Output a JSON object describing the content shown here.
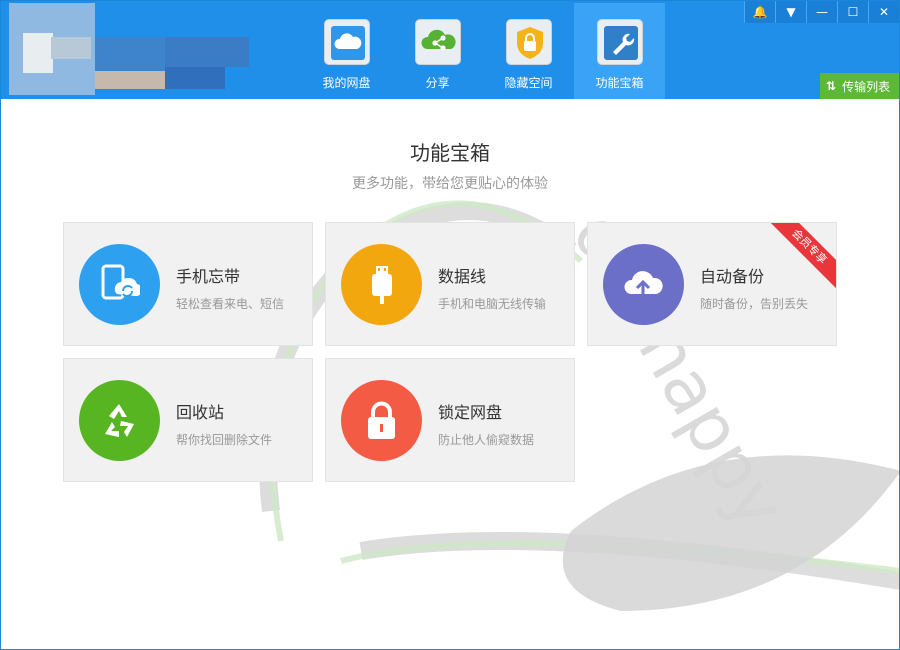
{
  "nav": {
    "items": [
      {
        "label": "我的网盘",
        "icon": "cloud-icon"
      },
      {
        "label": "分享",
        "icon": "share-icon"
      },
      {
        "label": "隐藏空间",
        "icon": "lock-shield-icon"
      },
      {
        "label": "功能宝箱",
        "icon": "wrench-icon",
        "active": true
      }
    ]
  },
  "window_controls": {
    "bell": "🔔",
    "menu": "▼",
    "minimize": "—",
    "maximize": "☐",
    "close": "✕"
  },
  "transfer": {
    "label": "传输列表",
    "icon": "transfer-icon"
  },
  "main": {
    "title": "功能宝箱",
    "subtitle": "更多功能，带给您更贴心的体验"
  },
  "cards": [
    {
      "name": "手机忘带",
      "desc": "轻松查看来电、短信",
      "icon": "phone-sync-icon",
      "color": "#2ea0f0"
    },
    {
      "name": "数据线",
      "desc": "手机和电脑无线传输",
      "icon": "usb-icon",
      "color": "#f3a70f"
    },
    {
      "name": "自动备份",
      "desc": "随时备份，告别丢失",
      "icon": "cloud-upload-icon",
      "color": "#6b6fc7",
      "badge": "会员专享"
    },
    {
      "name": "回收站",
      "desc": "帮你找回删除文件",
      "icon": "recycle-icon",
      "color": "#58b522"
    },
    {
      "name": "锁定网盘",
      "desc": "防止他人偷窥数据",
      "icon": "padlock-icon",
      "color": "#f35b45"
    }
  ],
  "colors": {
    "header": "#1f8fea",
    "active_tab": "#3aa3f5",
    "transfer": "#5db837",
    "ribbon": "#e8363b"
  }
}
